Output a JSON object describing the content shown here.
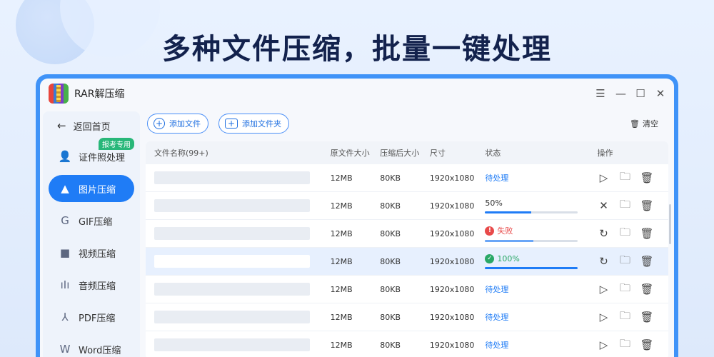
{
  "headline": "多种文件压缩，批量一键处理",
  "app": {
    "title": "RAR解压缩",
    "controls": {
      "menu": "☰",
      "minimize": "—",
      "maximize": "☐",
      "close": "✕"
    }
  },
  "sidebar": {
    "back_label": "返回首页",
    "items": [
      {
        "label": "证件照处理",
        "icon": "id-photo-icon",
        "badge": "报考专用"
      },
      {
        "label": "图片压缩",
        "icon": "image-compress-icon",
        "active": true
      },
      {
        "label": "GIF压缩",
        "icon": "gif-icon"
      },
      {
        "label": "视频压缩",
        "icon": "video-icon"
      },
      {
        "label": "音频压缩",
        "icon": "audio-icon"
      },
      {
        "label": "PDF压缩",
        "icon": "pdf-icon"
      },
      {
        "label": "Word压缩",
        "icon": "word-icon"
      }
    ]
  },
  "toolbar": {
    "add_file": "添加文件",
    "add_folder": "添加文件夹",
    "clear": "清空"
  },
  "table": {
    "headers": {
      "name": "文件名称(99+)",
      "orig": "原文件大小",
      "comp": "压缩后大小",
      "dim": "尺寸",
      "status": "状态",
      "ops": "操作"
    },
    "rows": [
      {
        "orig": "12MB",
        "comp": "80KB",
        "dim": "1920x1080",
        "status": "待处理"
      },
      {
        "orig": "12MB",
        "comp": "80KB",
        "dim": "1920x1080",
        "status": "50%",
        "progress": 0.5
      },
      {
        "orig": "12MB",
        "comp": "80KB",
        "dim": "1920x1080",
        "status": "失败",
        "progress": 0.52
      },
      {
        "orig": "12MB",
        "comp": "80KB",
        "dim": "1920x1080",
        "status": "100%",
        "progress": 1.0
      },
      {
        "orig": "12MB",
        "comp": "80KB",
        "dim": "1920x1080",
        "status": "待处理"
      },
      {
        "orig": "12MB",
        "comp": "80KB",
        "dim": "1920x1080",
        "status": "待处理"
      },
      {
        "orig": "12MB",
        "comp": "80KB",
        "dim": "1920x1080",
        "status": "待处理"
      }
    ]
  },
  "colors": {
    "accent": "#1f7cf6",
    "fail": "#e84a4a",
    "success": "#2aa867",
    "badge": "#28b779"
  }
}
